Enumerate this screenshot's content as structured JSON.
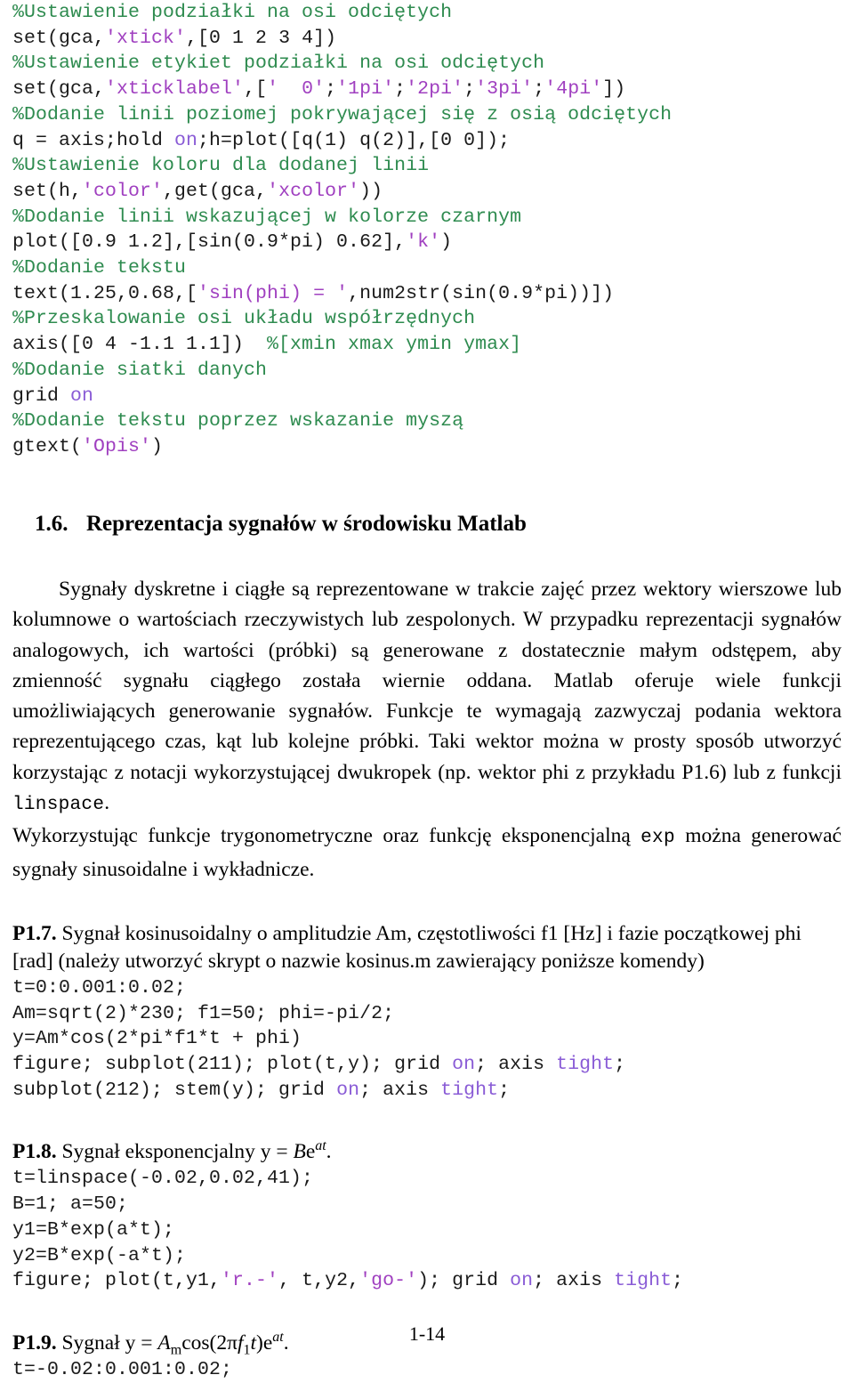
{
  "document": {
    "language": "pl",
    "page_number": "1-14"
  },
  "colors": {
    "comment": "#2e8b4f",
    "string": "#a040c0",
    "keyword": "#8a5cd6",
    "code_plain": "#1a1a1a",
    "body_text": "#000000",
    "background": "#ffffff"
  },
  "code_top": {
    "lines": [
      [
        {
          "t": "comment",
          "s": "%Ustawienie podziałki na osi odciętych"
        }
      ],
      [
        {
          "t": "plain",
          "s": "set(gca,"
        },
        {
          "t": "string",
          "s": "'xtick'"
        },
        {
          "t": "plain",
          "s": ",[0 1 2 3 4])"
        }
      ],
      [
        {
          "t": "comment",
          "s": "%Ustawienie etykiet podziałki na osi odciętych"
        }
      ],
      [
        {
          "t": "plain",
          "s": "set(gca,"
        },
        {
          "t": "string",
          "s": "'xticklabel'"
        },
        {
          "t": "plain",
          "s": ",["
        },
        {
          "t": "string",
          "s": "'  0'"
        },
        {
          "t": "plain",
          "s": ";"
        },
        {
          "t": "string",
          "s": "'1pi'"
        },
        {
          "t": "plain",
          "s": ";"
        },
        {
          "t": "string",
          "s": "'2pi'"
        },
        {
          "t": "plain",
          "s": ";"
        },
        {
          "t": "string",
          "s": "'3pi'"
        },
        {
          "t": "plain",
          "s": ";"
        },
        {
          "t": "string",
          "s": "'4pi'"
        },
        {
          "t": "plain",
          "s": "])"
        }
      ],
      [
        {
          "t": "comment",
          "s": "%Dodanie linii poziomej pokrywającej się z osią odciętych"
        }
      ],
      [
        {
          "t": "plain",
          "s": "q = axis;hold "
        },
        {
          "t": "keyword",
          "s": "on"
        },
        {
          "t": "plain",
          "s": ";h=plot([q(1) q(2)],[0 0]);"
        }
      ],
      [
        {
          "t": "comment",
          "s": "%Ustawienie koloru dla dodanej linii"
        }
      ],
      [
        {
          "t": "plain",
          "s": "set(h,"
        },
        {
          "t": "string",
          "s": "'color'"
        },
        {
          "t": "plain",
          "s": ",get(gca,"
        },
        {
          "t": "string",
          "s": "'xcolor'"
        },
        {
          "t": "plain",
          "s": "))"
        }
      ],
      [
        {
          "t": "comment",
          "s": "%Dodanie linii wskazującej w kolorze czarnym"
        }
      ],
      [
        {
          "t": "plain",
          "s": "plot([0.9 1.2],[sin(0.9*pi) 0.62],"
        },
        {
          "t": "string",
          "s": "'k'"
        },
        {
          "t": "plain",
          "s": ")"
        }
      ],
      [
        {
          "t": "comment",
          "s": "%Dodanie tekstu"
        }
      ],
      [
        {
          "t": "plain",
          "s": "text(1.25,0.68,["
        },
        {
          "t": "string",
          "s": "'sin(phi) = '"
        },
        {
          "t": "plain",
          "s": ",num2str(sin(0.9*pi))])"
        }
      ],
      [
        {
          "t": "comment",
          "s": "%Przeskalowanie osi układu współrzędnych"
        }
      ],
      [
        {
          "t": "plain",
          "s": "axis([0 4 -1.1 1.1])  "
        },
        {
          "t": "comment",
          "s": "%[xmin xmax ymin ymax]"
        }
      ],
      [
        {
          "t": "comment",
          "s": "%Dodanie siatki danych"
        }
      ],
      [
        {
          "t": "plain",
          "s": "grid "
        },
        {
          "t": "keyword",
          "s": "on"
        }
      ],
      [
        {
          "t": "comment",
          "s": "%Dodanie tekstu poprzez wskazanie myszą"
        }
      ],
      [
        {
          "t": "plain",
          "s": "gtext("
        },
        {
          "t": "string",
          "s": "'Opis'"
        },
        {
          "t": "plain",
          "s": ")"
        }
      ]
    ]
  },
  "section": {
    "number": "1.6.",
    "title": "Reprezentacja sygnałów w środowisku Matlab"
  },
  "paragraphs": {
    "p1_a": "Sygnały dyskretne i ciągłe są reprezentowane w trakcie zajęć przez wektory wierszowe lub kolumnowe o wartościach rzeczywistych lub zespolonych. W przypadku reprezentacji sygnałów analogowych, ich wartości (próbki) są generowane z dostatecznie małym odstępem, aby zmienność sygnału ciągłego została wiernie oddana. Matlab oferuje wiele funkcji umożliwiających generowanie sygnałów. Funkcje te wymagają zazwyczaj podania wektora reprezentującego czas, kąt lub kolejne próbki. Taki wektor można w prosty sposób utworzyć korzystając z notacji wykorzystującej dwukropek (np. wektor phi z przykładu P1.6) lub z funkcji ",
    "p1_code": "linspace",
    "p1_b": ".",
    "p2_a": "Wykorzystując funkcje trygonometryczne oraz funkcję eksponencjalną ",
    "p2_code": "exp",
    "p2_b": " można generować sygnały sinusoidalne i wykładnicze."
  },
  "problems": [
    {
      "label": "P1.7.",
      "text": " Sygnał kosinusoidalny o amplitudzie Am, częstotliwości f1 [Hz] i fazie początkowej phi [rad] (należy utworzyć skrypt o nazwie kosinus.m zawierający poniższe komendy)",
      "code": {
        "lines": [
          [
            {
              "t": "plain",
              "s": "t=0:0.001:0.02;"
            }
          ],
          [
            {
              "t": "plain",
              "s": "Am=sqrt(2)*230; f1=50; phi=-pi/2;"
            }
          ],
          [
            {
              "t": "plain",
              "s": "y=Am*cos(2*pi*f1*t + phi)"
            }
          ],
          [
            {
              "t": "plain",
              "s": "figure; subplot(211); plot(t,y); grid "
            },
            {
              "t": "keyword",
              "s": "on"
            },
            {
              "t": "plain",
              "s": "; axis "
            },
            {
              "t": "keyword",
              "s": "tight"
            },
            {
              "t": "plain",
              "s": ";"
            }
          ],
          [
            {
              "t": "plain",
              "s": "subplot(212); stem(y); grid "
            },
            {
              "t": "keyword",
              "s": "on"
            },
            {
              "t": "plain",
              "s": "; axis "
            },
            {
              "t": "keyword",
              "s": "tight"
            },
            {
              "t": "plain",
              "s": ";"
            }
          ]
        ]
      }
    },
    {
      "label": "P1.8.",
      "formula_parts": {
        "lead": " Sygnał eksponencjalny y = ",
        "italic_1": "B",
        "upright_1": "e",
        "superscript_1": "at",
        "tail": "."
      },
      "code": {
        "lines": [
          [
            {
              "t": "plain",
              "s": "t=linspace(-0.02,0.02,41);"
            }
          ],
          [
            {
              "t": "plain",
              "s": "B=1; a=50;"
            }
          ],
          [
            {
              "t": "plain",
              "s": "y1=B*exp(a*t);"
            }
          ],
          [
            {
              "t": "plain",
              "s": "y2=B*exp(-a*t);"
            }
          ],
          [
            {
              "t": "plain",
              "s": "figure; plot(t,y1,"
            },
            {
              "t": "string",
              "s": "'r.-'"
            },
            {
              "t": "plain",
              "s": ", t,y2,"
            },
            {
              "t": "string",
              "s": "'go-'"
            },
            {
              "t": "plain",
              "s": "); grid "
            },
            {
              "t": "keyword",
              "s": "on"
            },
            {
              "t": "plain",
              "s": "; axis "
            },
            {
              "t": "keyword",
              "s": "tight"
            },
            {
              "t": "plain",
              "s": ";"
            }
          ]
        ]
      }
    },
    {
      "label": "P1.9.",
      "formula_parts": {
        "lead": " Sygnał y = ",
        "italic_A": "A",
        "sub_m": "m",
        "cos_open": "cos(2π",
        "italic_f": "f",
        "sub_1": "1",
        "italic_t": "t",
        "close_paren": ")",
        "upright_e": "e",
        "superscript_at": "at",
        "tail": "."
      },
      "code": {
        "lines": [
          [
            {
              "t": "plain",
              "s": "t=-0.02:0.001:0.02;"
            }
          ]
        ]
      }
    }
  ]
}
